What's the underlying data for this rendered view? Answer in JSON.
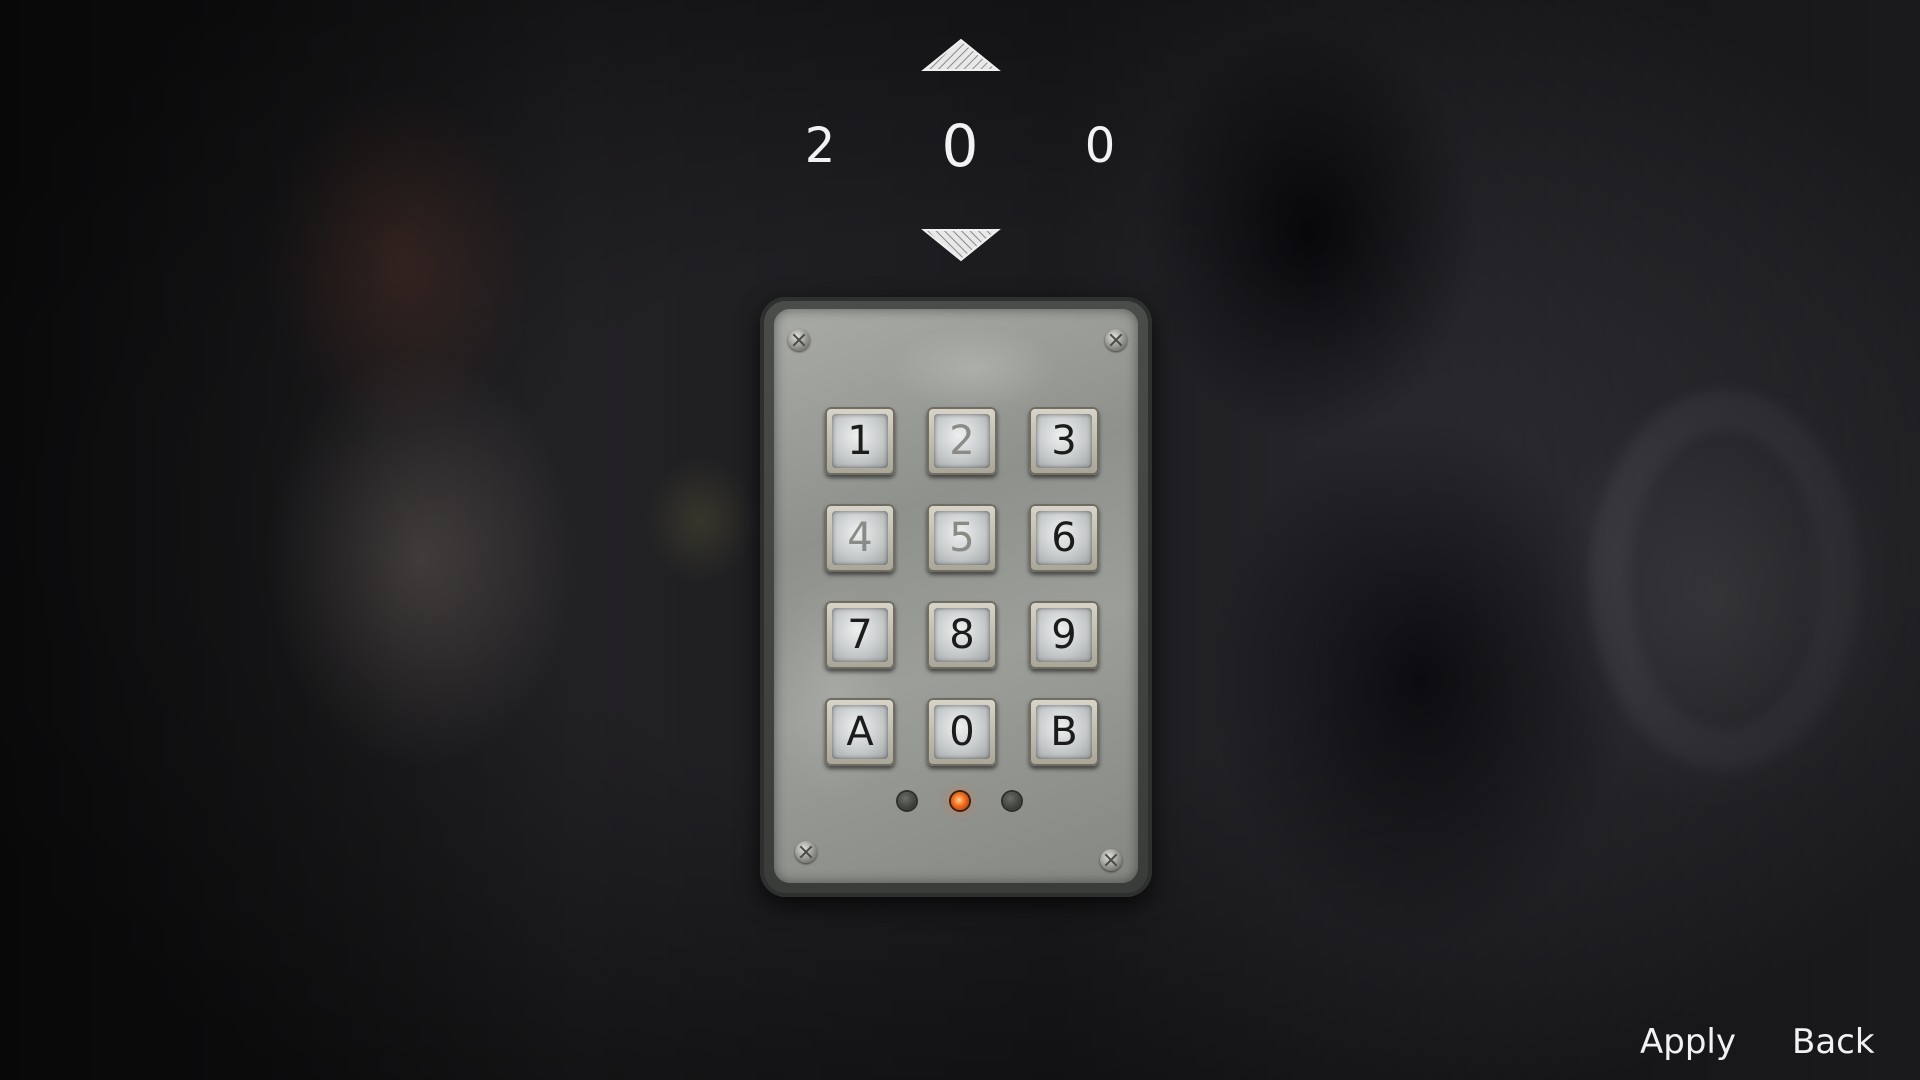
{
  "code_selector": {
    "digits": [
      "2",
      "0",
      "0"
    ],
    "selected_index": 1,
    "up_arrow_icon": "triangle-up-icon",
    "down_arrow_icon": "triangle-down-icon"
  },
  "keypad": {
    "keys": [
      "1",
      "2",
      "3",
      "4",
      "5",
      "6",
      "7",
      "8",
      "9",
      "A",
      "0",
      "B"
    ],
    "worn_keys": [
      "2",
      "4",
      "5"
    ],
    "indicator_lights": [
      {
        "state": "off",
        "color": "#3a3d38"
      },
      {
        "state": "on",
        "color": "#f06a1c"
      },
      {
        "state": "off",
        "color": "#3a3d38"
      }
    ]
  },
  "actions": {
    "apply_label": "Apply",
    "back_label": "Back"
  }
}
